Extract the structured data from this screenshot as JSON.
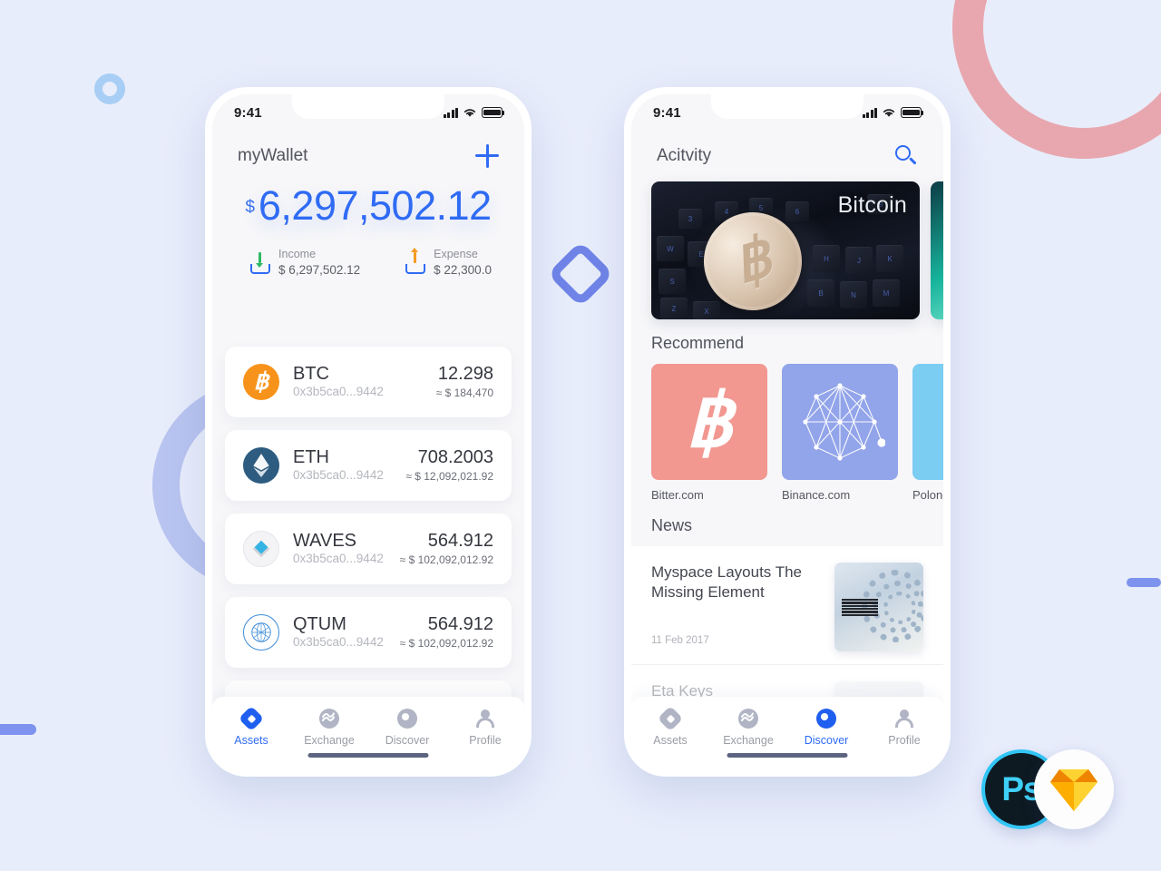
{
  "canvas": {
    "background_color": "#e8edfb",
    "decorations": [
      {
        "name": "ring-pink",
        "color": "#e8a7ae"
      },
      {
        "name": "ring-periwinkle",
        "color": "#b9c4f0"
      },
      {
        "name": "ring-lightblue",
        "color": "#a8cef5"
      },
      {
        "name": "bar-left",
        "color": "#7d93ee"
      },
      {
        "name": "bar-right",
        "color": "#7d93ee"
      },
      {
        "name": "diamond-outline",
        "color": "#7084e8"
      }
    ]
  },
  "tool_badges": {
    "photoshop_label": "Ps",
    "photoshop_color": "#3fd0f7",
    "sketch_color": "#f7a823"
  },
  "phone_assets": {
    "status": {
      "time": "9:41",
      "signal_icon": "signal-bars-icon",
      "wifi_icon": "wifi-icon",
      "battery_icon": "battery-icon"
    },
    "header": {
      "title": "myWallet",
      "add_icon": "plus-icon"
    },
    "balance": {
      "currency_symbol": "$",
      "amount": "6,297,502.12",
      "accent_color": "#2f6bf4"
    },
    "flows": [
      {
        "label": "Income",
        "value": "$ 6,297,502.12",
        "icon": "download-tray-icon",
        "arrow_color": "#2fb865"
      },
      {
        "label": "Expense",
        "value": "$ 22,300.0",
        "icon": "upload-tray-icon",
        "arrow_color": "#f59a22"
      }
    ],
    "assets": [
      {
        "symbol": "BTC",
        "address": "0x3b5ca0...9442",
        "amount": "12.298",
        "fiat": "≈ $ 184,470",
        "icon": "bitcoin-coin-icon",
        "color": "#f7931a"
      },
      {
        "symbol": "ETH",
        "address": "0x3b5ca0...9442",
        "amount": "708.2003",
        "fiat": "≈ $ 12,092,021.92",
        "icon": "ethereum-coin-icon",
        "color": "#2d5c80"
      },
      {
        "symbol": "WAVES",
        "address": "0x3b5ca0...9442",
        "amount": "564.912",
        "fiat": "≈ $ 102,092,012.92",
        "icon": "waves-coin-icon",
        "color": "#34b3e4"
      },
      {
        "symbol": "QTUM",
        "address": "0x3b5ca0...9442",
        "amount": "564.912",
        "fiat": "≈ $ 102,092,012.92",
        "icon": "qtum-coin-icon",
        "color": "#3b8bd8"
      }
    ],
    "tabs": [
      {
        "label": "Assets",
        "icon": "diamond-icon",
        "active": true
      },
      {
        "label": "Exchange",
        "icon": "wave-circle-icon",
        "active": false
      },
      {
        "label": "Discover",
        "icon": "compass-circle-icon",
        "active": false
      },
      {
        "label": "Profile",
        "icon": "person-icon",
        "active": false
      }
    ]
  },
  "phone_discover": {
    "status": {
      "time": "9:41",
      "signal_icon": "signal-bars-icon",
      "wifi_icon": "wifi-icon",
      "battery_icon": "battery-icon"
    },
    "header": {
      "title": "Acitvity",
      "search_icon": "search-icon"
    },
    "hero": [
      {
        "label": "Bitcoin",
        "image": "bitcoin-coin-on-keyboard-photo"
      },
      {
        "label": "",
        "image": "teal-abstract-photo"
      }
    ],
    "recommend": {
      "section_title": "Recommend",
      "items": [
        {
          "name": "Bitter.com",
          "tile_color": "#f29891",
          "icon": "bitcoin-b-icon"
        },
        {
          "name": "Binance.com",
          "tile_color": "#92a4ea",
          "icon": "network-polygon-icon"
        },
        {
          "name": "Polone",
          "tile_color": "#7ccdf2",
          "icon": "dot-icon"
        }
      ]
    },
    "news": {
      "section_title": "News",
      "items": [
        {
          "title": "Myspace Layouts The Missing Element",
          "date": "11 Feb 2017",
          "thumb": "ibm-server-photo"
        },
        {
          "title": "Eta Keys",
          "date": "",
          "thumb": "avatar-photo"
        }
      ]
    },
    "tabs": [
      {
        "label": "Assets",
        "icon": "diamond-icon",
        "active": false
      },
      {
        "label": "Exchange",
        "icon": "wave-circle-icon",
        "active": false
      },
      {
        "label": "Discover",
        "icon": "compass-circle-icon",
        "active": true
      },
      {
        "label": "Profile",
        "icon": "person-icon",
        "active": false
      }
    ]
  }
}
